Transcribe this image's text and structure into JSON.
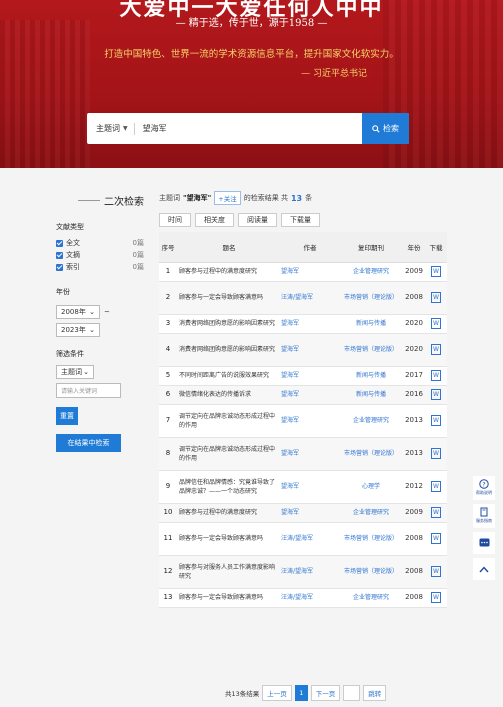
{
  "banner": {
    "slogan": "大爱中一大爱任何人中中",
    "subtitle": "— 精于选，传于世，源于1958 —",
    "quote": "打造中国特色、世界一流的学术资源信息平台，提升国家文化软实力。",
    "quote_author": "— 习近平总书记"
  },
  "search": {
    "field_label": "主题词",
    "query": "望海军",
    "button_label": "检索"
  },
  "sidebar": {
    "title": "二次检索",
    "doc_type_label": "文献类型",
    "doc_types": [
      {
        "label": "全文",
        "count": "0篇"
      },
      {
        "label": "文摘",
        "count": "0篇"
      },
      {
        "label": "索引",
        "count": "0篇"
      }
    ],
    "year_label": "年份",
    "year_from": "2008年",
    "year_sep": "~",
    "year_to": "2023年",
    "filter_label": "筛选条件",
    "filter_field": "主题词",
    "filter_placeholder": "请输入关键词",
    "reset_label": "重置",
    "search_in_results_label": "在结果中检索"
  },
  "results": {
    "field": "主题词",
    "query": "\"望海军\"",
    "follow_label": "+关注",
    "summary_prefix": "的检索结果 共",
    "count": "13",
    "summary_suffix": "条",
    "sort_buttons": [
      "时间",
      "相关度",
      "阅读量",
      "下载量"
    ],
    "columns": [
      "序号",
      "题名",
      "作者",
      "复印期刊",
      "年份",
      "下载"
    ],
    "rows": [
      {
        "no": "1",
        "title": "顾客参与过程中的满意度研究",
        "author": "望海军",
        "journal": "企业管理研究",
        "year": "2009"
      },
      {
        "no": "2",
        "title": "顾客参与一定会导致顾客满意吗",
        "author": "汪涛/望海军",
        "journal": "市场营销（理论版）",
        "year": "2008"
      },
      {
        "no": "3",
        "title": "消费者网络团购意愿的影响因素研究",
        "author": "望海军",
        "journal": "新闻与传播",
        "year": "2020"
      },
      {
        "no": "4",
        "title": "消费者网络团购意愿的影响因素研究",
        "author": "望海军",
        "journal": "市场营销（理论版）",
        "year": "2020"
      },
      {
        "no": "5",
        "title": "不同时间距离广告的说服效果研究",
        "author": "望海军",
        "journal": "新闻与传播",
        "year": "2017"
      },
      {
        "no": "6",
        "title": "微信情绪化表达的传播诉求",
        "author": "望海军",
        "journal": "新闻与传播",
        "year": "2016"
      },
      {
        "no": "7",
        "title": "调节定向在品牌忠诚动态形成过程中的作用",
        "author": "望海军",
        "journal": "企业管理研究",
        "year": "2013"
      },
      {
        "no": "8",
        "title": "调节定向在品牌忠诚动态形成过程中的作用",
        "author": "望海军",
        "journal": "市场营销（理论版）",
        "year": "2013"
      },
      {
        "no": "9",
        "title": "品牌信任和品牌情感：究竟谁导致了品牌忠诚？——一个动态研究",
        "author": "望海军",
        "journal": "心理学",
        "year": "2012"
      },
      {
        "no": "10",
        "title": "顾客参与过程中的满意度研究",
        "author": "望海军",
        "journal": "企业管理研究",
        "year": "2009"
      },
      {
        "no": "11",
        "title": "顾客参与一定会导致顾客满意吗",
        "author": "汪涛/望海军",
        "journal": "市场营销（理论版）",
        "year": "2008"
      },
      {
        "no": "12",
        "title": "顾客参与对服务人员工作满意度影响研究",
        "author": "汪涛/望海军",
        "journal": "市场营销（理论版）",
        "year": "2008"
      },
      {
        "no": "13",
        "title": "顾客参与一定会导致顾客满意吗",
        "author": "汪涛/望海军",
        "journal": "企业管理研究",
        "year": "2008"
      }
    ],
    "download_icon_text": "W"
  },
  "pagination": {
    "total_label": "共13条结果",
    "prev_label": "上一页",
    "current_page": "1",
    "next_label": "下一页",
    "jump_label": "跳转"
  },
  "float_bar": {
    "help_label": "帮助说明",
    "manual_label": "服务指南"
  },
  "colors": {
    "banner_red": "#a41418",
    "accent_blue": "#1f7bd6",
    "link_blue": "#2e74d0",
    "quote_gold": "#f6d36a"
  }
}
